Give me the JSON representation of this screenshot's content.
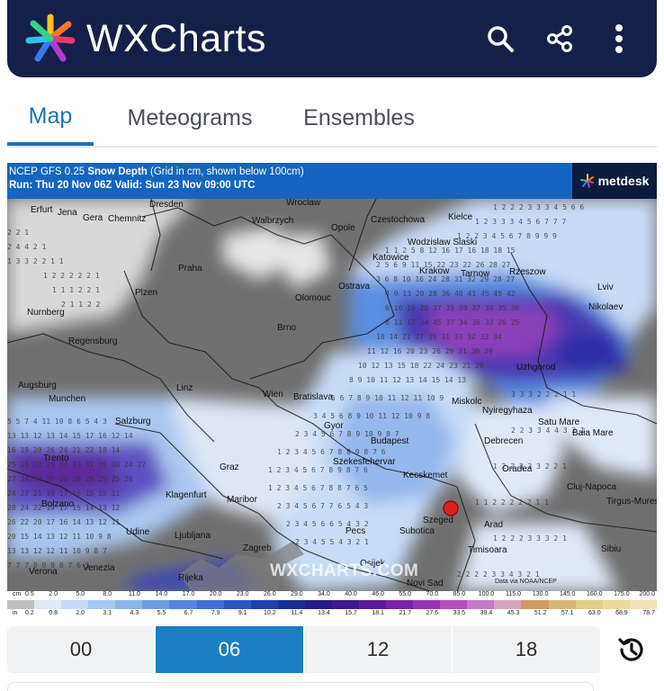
{
  "header": {
    "app_name": "WXCharts",
    "icons": {
      "logo": "asterisk-logo-icon",
      "search": "search-icon",
      "share": "share-icon",
      "menu": "more-vertical-icon"
    }
  },
  "tabs": [
    {
      "label": "Map",
      "active": true
    },
    {
      "label": "Meteograms",
      "active": false
    },
    {
      "label": "Ensembles",
      "active": false
    }
  ],
  "map": {
    "title_prefix": "NCEP GFS 0.25 ",
    "title_bold": "Snow Depth",
    "title_suffix": " (Grid in cm, shown below 100cm)",
    "run_line": "Run: Thu 20 Nov 06Z Valid: Sun 23 Nov 09:00 UTC",
    "brand": "metdesk",
    "watermark": "WXCHARTS.COM",
    "credit": "Data via NOAA/NCEP",
    "cities": [
      "Erfurt",
      "Jena",
      "Gera",
      "Chemnitz",
      "Dresden",
      "Wroclaw",
      "Walbrzych",
      "Opole",
      "Czestochowa",
      "Kielce",
      "Katowice",
      "Wodzislaw Slaski",
      "Krakow",
      "Tarnow",
      "Rzeszow",
      "Lviv",
      "Nikolaev",
      "Praha",
      "Plzen",
      "Olomouc",
      "Ostrava",
      "Nurnberg",
      "Regensburg",
      "Brno",
      "Augsburg",
      "Linz",
      "Wien",
      "Bratislava",
      "Munchen",
      "Miskolc",
      "Nyiregyhaza",
      "Uzhgorod",
      "Satu Mare",
      "Baia Mare",
      "Salzburg",
      "Gyor",
      "Budapest",
      "Debrecen",
      "Graz",
      "Szekesfehervar",
      "Oradea",
      "Klagenfurt",
      "Maribor",
      "Kecskemet",
      "Cluj-Napoca",
      "Bolzano",
      "Szeged",
      "Arad",
      "Tirgus-Mures",
      "Udine",
      "Ljubljana",
      "Pecs",
      "Subotica",
      "Timisoara",
      "Zagreb",
      "Verona",
      "Venezia",
      "Osijek",
      "Rijeka",
      "Novi Sad",
      "Sibiu",
      "Trento"
    ],
    "selected_point_color": "#e02020",
    "legend": {
      "cm_prefix": "cm",
      "cm_values": [
        "0.5",
        "2.0",
        "5.0",
        "8.0",
        "11.0",
        "14.0",
        "17.0",
        "20.0",
        "23.0",
        "26.0",
        "29.0",
        "34.0",
        "40.0",
        "46.0",
        "55.0",
        "70.0",
        "85.0",
        "100.0",
        "115.0",
        "130.0",
        "145.0",
        "160.0",
        "175.0",
        "200.0"
      ],
      "in_prefix": "in",
      "in_values": [
        "0.2",
        "0.8",
        "2.0",
        "3.1",
        "4.3",
        "5.5",
        "6.7",
        "7.9",
        "9.1",
        "10.2",
        "11.4",
        "13.4",
        "15.7",
        "18.1",
        "21.7",
        "27.6",
        "33.5",
        "39.4",
        "45.3",
        "51.2",
        "57.1",
        "63.0",
        "68.9",
        "78.7"
      ],
      "colors": [
        "#bfbfbf",
        "#dfe9f8",
        "#c6dbf6",
        "#a9c9f2",
        "#8bb4ec",
        "#6f9ee5",
        "#5386dc",
        "#3f6fd2",
        "#2d56c4",
        "#2140ae",
        "#1b2f94",
        "#2a1c88",
        "#3e1a8c",
        "#5a1d97",
        "#7a25a6",
        "#9a33b5",
        "#b44dc2",
        "#c67ac6",
        "#d7a7c0",
        "#cf9b63",
        "#d7b870",
        "#e0cf84",
        "#ead99a",
        "#f0e3b5"
      ]
    }
  },
  "time_selector": {
    "options": [
      {
        "label": "00",
        "active": false
      },
      {
        "label": "06",
        "active": true
      },
      {
        "label": "12",
        "active": false
      },
      {
        "label": "18",
        "active": false
      }
    ],
    "history_icon": "history-icon"
  }
}
